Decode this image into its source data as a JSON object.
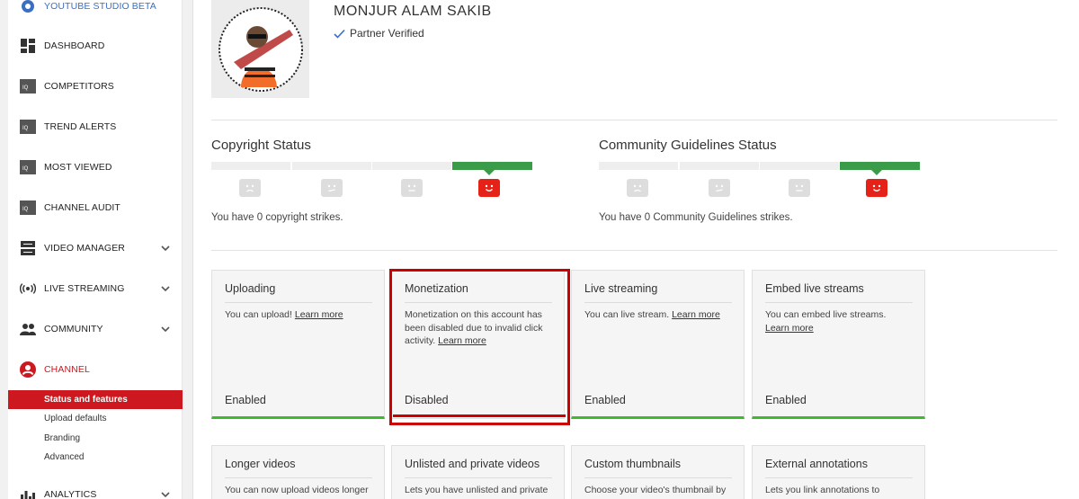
{
  "sidebar": {
    "studio_label": "YOUTUBE STUDIO BETA",
    "items": [
      {
        "label": "DASHBOARD",
        "icon": "dashboard-icon"
      },
      {
        "label": "COMPETITORS",
        "icon": "iq-icon"
      },
      {
        "label": "TREND ALERTS",
        "icon": "iq-icon"
      },
      {
        "label": "MOST VIEWED",
        "icon": "iq-icon"
      },
      {
        "label": "CHANNEL AUDIT",
        "icon": "iq-icon"
      },
      {
        "label": "VIDEO MANAGER",
        "icon": "video-manager-icon"
      },
      {
        "label": "LIVE STREAMING",
        "icon": "live-streaming-icon"
      },
      {
        "label": "COMMUNITY",
        "icon": "community-icon"
      },
      {
        "label": "CHANNEL",
        "icon": "channel-icon"
      },
      {
        "label": "ANALYTICS",
        "icon": "analytics-icon"
      }
    ],
    "channel_sub": [
      "Status and features",
      "Upload defaults",
      "Branding",
      "Advanced"
    ],
    "accent": "#cc181e"
  },
  "header": {
    "channel_name": "MONJUR ALAM SAKIB",
    "verified_label": "Partner Verified"
  },
  "copyright": {
    "title": "Copyright Status",
    "text": "You have 0 copyright strikes."
  },
  "community": {
    "title": "Community Guidelines Status",
    "text": "You have 0 Community Guidelines strikes."
  },
  "features": [
    {
      "title": "Uploading",
      "desc": "You can upload!",
      "link": "Learn more",
      "state": "Enabled"
    },
    {
      "title": "Monetization",
      "desc": "Monetization on this account has been disabled due to invalid click activity.",
      "link": "Learn more",
      "state": "Disabled"
    },
    {
      "title": "Live streaming",
      "desc": "You can live stream.",
      "link": "Learn more",
      "state": "Enabled"
    },
    {
      "title": "Embed live streams",
      "desc": "You can embed live streams.",
      "link": "Learn more",
      "state": "Enabled"
    },
    {
      "title": "Longer videos",
      "desc": "You can now upload videos longer"
    },
    {
      "title": "Unlisted and private videos",
      "desc": "Lets you have unlisted and private"
    },
    {
      "title": "Custom thumbnails",
      "desc": "Choose your video's thumbnail by"
    },
    {
      "title": "External annotations",
      "desc": "Lets you link annotations to"
    }
  ],
  "colors": {
    "enabled": "#3dbb2c",
    "highlight": "#cc0000",
    "active_face": "#e62117",
    "meter_on": "#3a9c48"
  }
}
